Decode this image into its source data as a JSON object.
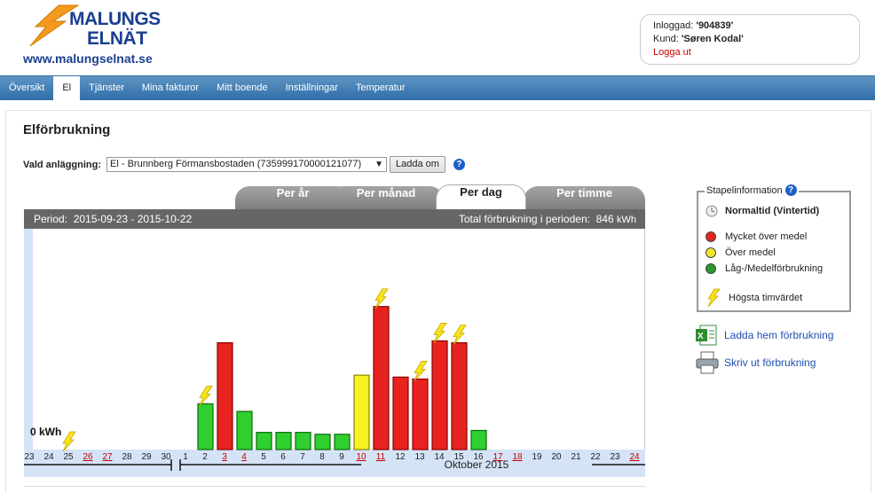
{
  "logo": {
    "line1": "MALUNGS",
    "line2": "ELNÄT",
    "site": "www.malungselnat.se"
  },
  "user": {
    "login_label": "Inloggad: ",
    "login_value": "'904839'",
    "customer_label": "Kund: ",
    "customer_value": "'Søren Kodal'",
    "logout": "Logga ut"
  },
  "nav": {
    "tabs": [
      "Översikt",
      "El",
      "Tjänster",
      "Mina fakturor",
      "Mitt boende",
      "Inställningar",
      "Temperatur"
    ],
    "active": "El"
  },
  "page": {
    "title": "Elförbrukning"
  },
  "facility": {
    "label": "Vald anläggning:",
    "value": "El - Brunnberg Förmansbostaden (735999170000121077)",
    "reload_button": "Ladda om",
    "help": "?"
  },
  "period_tabs": {
    "labels": [
      "Per år",
      "Per månad",
      "Per dag",
      "Per timme"
    ],
    "active": "Per dag"
  },
  "chart_header": {
    "period_label": "Period:",
    "period_value": "2015-09-23 - 2015-10-22",
    "total_label": "Total förbrukning i perioden:",
    "total_value": "846",
    "total_unit": "kWh"
  },
  "chart_data": {
    "type": "bar",
    "categories": [
      "23",
      "24",
      "25",
      "26",
      "27",
      "28",
      "29",
      "30",
      "1",
      "2",
      "3",
      "4",
      "5",
      "6",
      "7",
      "8",
      "9",
      "10",
      "11",
      "12",
      "13",
      "14",
      "15",
      "16",
      "17",
      "18",
      "19",
      "20",
      "21",
      "22",
      "23",
      "24"
    ],
    "weekend_red": [
      "26",
      "27",
      "3",
      "4",
      "10",
      "11",
      "17",
      "18",
      "24"
    ],
    "values": [
      0,
      0,
      0,
      0,
      0,
      0,
      0,
      0,
      0,
      24,
      56,
      20,
      9,
      9,
      9,
      8,
      8,
      39,
      75,
      38,
      37,
      57,
      56,
      10,
      0,
      0,
      0,
      0,
      0,
      0,
      0,
      0
    ],
    "levels": [
      "",
      "",
      "",
      "",
      "",
      "",
      "",
      "",
      "",
      "green",
      "red",
      "green",
      "green",
      "green",
      "green",
      "green",
      "green",
      "yellow",
      "red",
      "red",
      "red",
      "red",
      "red",
      "green",
      "",
      "",
      "",
      "",
      "",
      "",
      "",
      ""
    ],
    "peak_markers": [
      2,
      9,
      18,
      20,
      21,
      22
    ],
    "zero_label": "0 kWh",
    "month_label": "Oktober 2015",
    "colors": {
      "red": "#e8231f",
      "yellow": "#f7f224",
      "green": "#2fcf2f",
      "weekend": "#cc0000"
    }
  },
  "legend": {
    "title": "Stapelinformation",
    "time_mode": "Normaltid (Vintertid)",
    "items": [
      {
        "color": "#e8231f",
        "label": "Mycket över medel"
      },
      {
        "color": "#f0e828",
        "label": "Över medel"
      },
      {
        "color": "#2a9a2a",
        "label": "Låg-/Medelförbrukning"
      }
    ],
    "peak_label": "Högsta timvärdet"
  },
  "actions": {
    "download": "Ladda hem förbrukning",
    "print": "Skriv ut förbrukning"
  }
}
